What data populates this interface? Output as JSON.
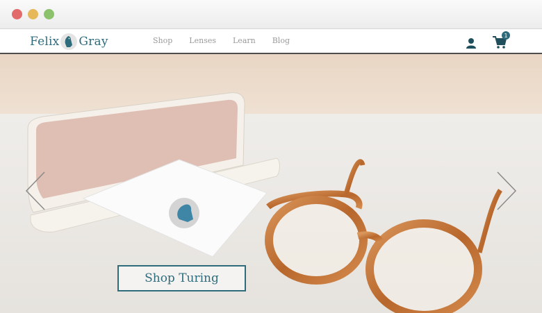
{
  "window": {
    "controls": [
      "close",
      "minimize",
      "maximize"
    ]
  },
  "brand": {
    "name_left": "Felix",
    "name_right": "Gray",
    "logo_icon": "owl-icon",
    "color": "#2f6c7b"
  },
  "nav": {
    "links": [
      "Shop",
      "Lenses",
      "Learn",
      "Blog"
    ]
  },
  "header_icons": {
    "user": "user-icon",
    "cart": "cart-icon",
    "cart_count": "1"
  },
  "hero": {
    "cta_label": "Shop Turing",
    "prev_icon": "chevron-left-icon",
    "next_icon": "chevron-right-icon"
  }
}
